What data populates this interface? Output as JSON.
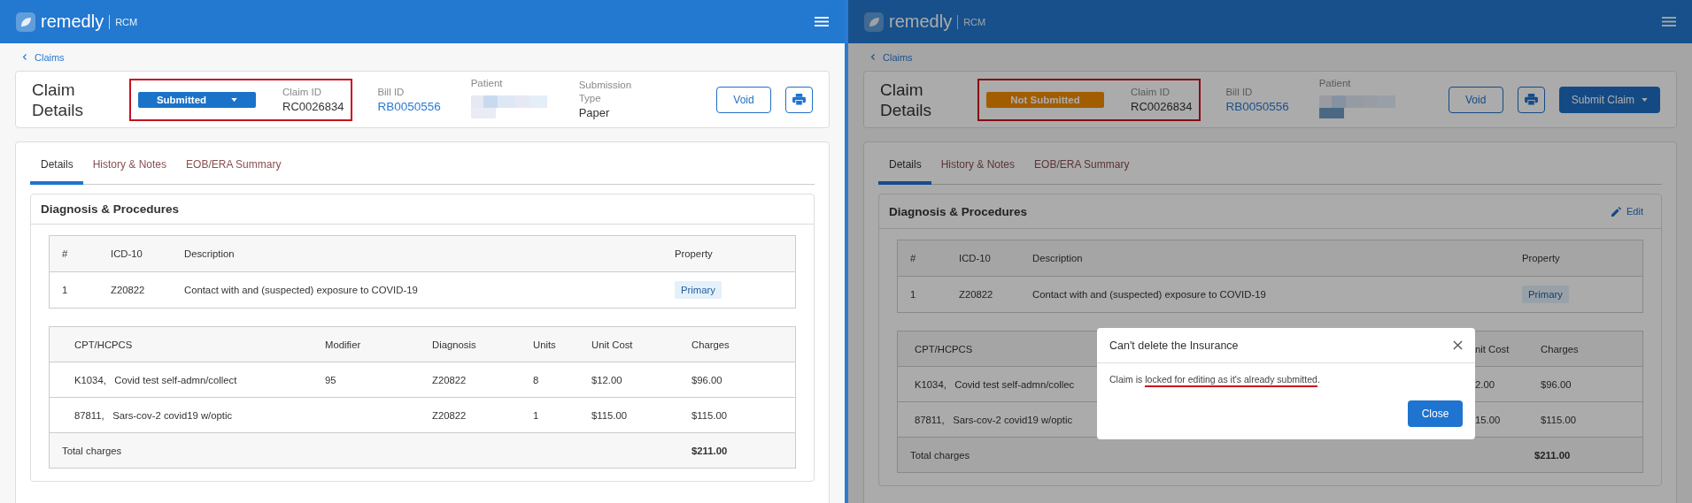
{
  "screens": [
    {
      "header": {
        "brand": "remedly",
        "product": "RCM"
      },
      "breadcrumb": "Claims",
      "title": "Claim Details",
      "highlighted": true,
      "status": {
        "label": "Submitted",
        "kind": "submitted",
        "dropdown": true
      },
      "claim_id": {
        "label": "Claim ID",
        "value": "RC0026834"
      },
      "fields": [
        {
          "label": "Bill ID",
          "value": "RB0050556",
          "kind": "link"
        },
        {
          "label": "Patient",
          "kind": "redacted"
        },
        {
          "label": "Submission Type",
          "value": "Paper",
          "kind": "text"
        }
      ],
      "actions": [
        {
          "kind": "outline",
          "label": "Void"
        },
        {
          "kind": "print"
        }
      ],
      "tabs": [
        {
          "label": "Details",
          "selected": true
        },
        {
          "label": "History & Notes",
          "selected": false
        },
        {
          "label": "EOB/ERA Summary",
          "selected": false
        }
      ],
      "section": {
        "title": "Diagnosis & Procedures"
      },
      "diagnoses": {
        "columns": [
          "#",
          "ICD-10",
          "Description",
          "Property"
        ],
        "rows": [
          {
            "cells": [
              "1",
              "Z20822",
              "Contact with and (suspected) exposure to COVID-19"
            ],
            "tag": "Primary"
          }
        ]
      },
      "procedures": {
        "columns": [
          "CPT/HCPCS",
          "Modifier",
          "Diagnosis",
          "Units",
          "Unit Cost",
          "Charges"
        ],
        "rows": [
          [
            "K1034,   Covid test self-admn/collect",
            "95",
            "Z20822",
            "8",
            "$12.00",
            "$96.00"
          ],
          [
            "87811,   Sars-cov-2 covid19 w/optic",
            "",
            "Z20822",
            "1",
            "$115.00",
            "$115.00"
          ]
        ],
        "total_label": "Total charges",
        "total": "$211.00"
      }
    },
    {
      "header": {
        "brand": "remedly",
        "product": "RCM"
      },
      "breadcrumb": "Claims",
      "title": "Claim Details",
      "highlighted": true,
      "status": {
        "label": "Not Submitted",
        "kind": "not_submitted",
        "dropdown": false
      },
      "claim_id": {
        "label": "Claim ID",
        "value": "RC0026834"
      },
      "fields": [
        {
          "label": "Bill ID",
          "value": "RB0050556",
          "kind": "link"
        },
        {
          "label": "Patient",
          "kind": "redacted"
        }
      ],
      "actions": [
        {
          "kind": "outline",
          "label": "Void"
        },
        {
          "kind": "print"
        },
        {
          "kind": "primary",
          "label": "Submit Claim"
        }
      ],
      "tabs": [
        {
          "label": "Details",
          "selected": true
        },
        {
          "label": "History & Notes",
          "selected": false
        },
        {
          "label": "EOB/ERA Summary",
          "selected": false
        }
      ],
      "section": {
        "title": "Diagnosis & Procedures",
        "edit": "Edit"
      },
      "diagnoses": {
        "columns": [
          "#",
          "ICD-10",
          "Description",
          "Property"
        ],
        "rows": [
          {
            "cells": [
              "1",
              "Z20822",
              "Contact with and (suspected) exposure to COVID-19"
            ],
            "tag": "Primary"
          }
        ]
      },
      "procedures": {
        "columns": [
          "CPT/HCPCS",
          "nit Cost",
          "Charges"
        ],
        "rows": [
          [
            "K1034,   Covid test self-admn/collec",
            "2.00",
            "$96.00"
          ],
          [
            "87811,   Sars-cov-2 covid19 w/optic",
            "15.00",
            "$115.00"
          ]
        ],
        "total_label": "Total charges",
        "total": "$211.00"
      },
      "modal": {
        "title": "Can't delete the Insurance",
        "message": [
          {
            "text": "Claim is ",
            "underlined": false
          },
          {
            "text": "locked for editing as it's already submitted",
            "underlined": true
          },
          {
            "text": ".",
            "underlined": false
          }
        ],
        "button": "Close"
      }
    }
  ]
}
